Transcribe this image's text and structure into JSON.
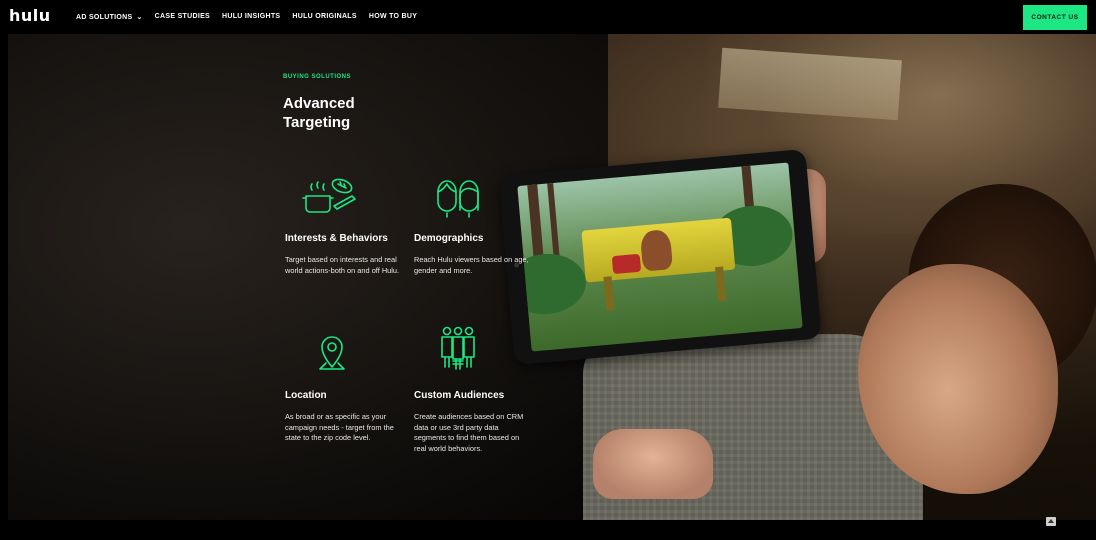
{
  "nav": {
    "logo": "hulu",
    "links": [
      "AD SOLUTIONS",
      "CASE STUDIES",
      "HULU INSIGHTS",
      "HULU ORIGINALS",
      "HOW TO BUY"
    ],
    "contact_label": "CONTACT US"
  },
  "hero": {
    "eyebrow": "BUYING SOLUTIONS",
    "title": "Advanced Targeting"
  },
  "features": [
    {
      "title": "Interests & Behaviors",
      "description": "Target based on interests and real world actions-both on and off Hulu.",
      "icon": "interests-icon"
    },
    {
      "title": "Demographics",
      "description": "Reach Hulu viewers based on age, gender and more.",
      "icon": "demographics-icon"
    },
    {
      "title": "Location",
      "description": "As broad or as specific as your campaign needs - target from the state to the zip code level.",
      "icon": "location-pin-icon"
    },
    {
      "title": "Custom Audiences",
      "description": "Create audiences based on CRM data or use 3rd party data segments to find them based on real world behaviors.",
      "icon": "custom-audiences-icon"
    }
  ],
  "colors": {
    "accent": "#1ce783",
    "background": "#000000",
    "text": "#ffffff"
  }
}
